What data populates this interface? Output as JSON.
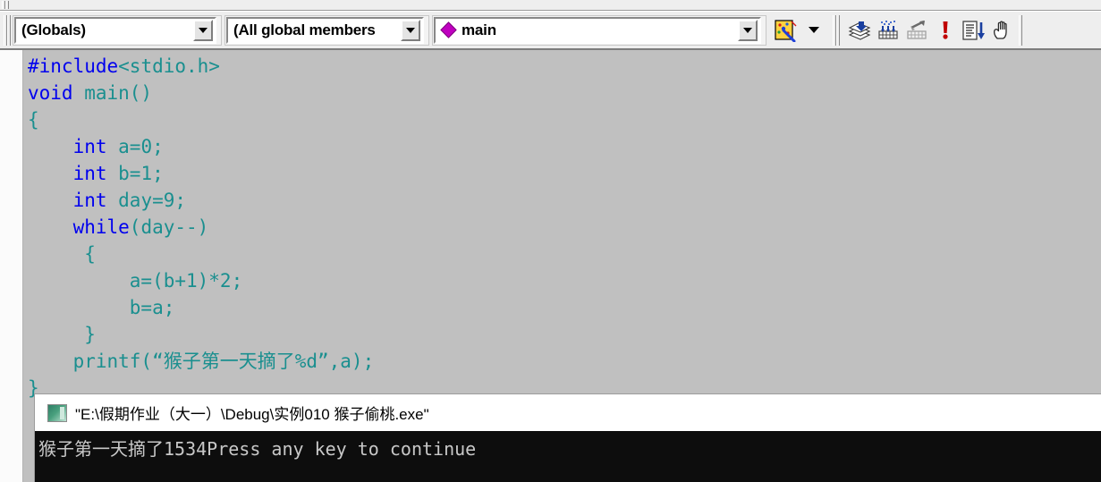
{
  "window": {
    "app": "Microsoft Visual C++ 6.0",
    "background_color": "#c0c0c0"
  },
  "toolbar": {
    "combos": [
      {
        "name": "class-combo",
        "value": "(Globals)",
        "icon": "none"
      },
      {
        "name": "filter-combo",
        "value": "(All global members",
        "icon": "none"
      },
      {
        "name": "member-combo",
        "value": "main",
        "icon": "diamond-magenta"
      }
    ],
    "wizard_button": {
      "label": "WizardBar Actions",
      "icon": "wizard-wand-icon"
    },
    "wizard_dropdown": {
      "label": "WizardBar Actions Menu",
      "icon": "caret-down-icon"
    },
    "debug_buttons": [
      {
        "name": "insert-remove-breakpoint",
        "label": "Insert/Remove Breakpoint",
        "icon": "breakpoint-layers-icon",
        "enabled": true
      },
      {
        "name": "enable-breakpoint",
        "label": "Enable Breakpoint",
        "icon": "enable-breakpoint-icon",
        "enabled": true
      },
      {
        "name": "disable-breakpoint",
        "label": "Disable Breakpoint",
        "icon": "disable-breakpoint-icon",
        "enabled": false
      },
      {
        "name": "breakpoints",
        "label": "Breakpoints",
        "icon": "red-exclamation-icon",
        "enabled": true
      },
      {
        "name": "show-next-statement",
        "label": "Show Next Statement",
        "icon": "next-statement-icon",
        "enabled": true
      },
      {
        "name": "pointer-hand",
        "label": "Hand Tool",
        "icon": "hand-icon",
        "enabled": true
      }
    ]
  },
  "colors": {
    "keyword": "#0000ee",
    "plain": "#1a8f8f",
    "editor_bg": "#c0c0c0",
    "gutter_bg": "#fbfbfb",
    "console_bg": "#0d0d0d",
    "console_fg": "#c8c8c8",
    "diamond": "#c000c0"
  },
  "editor": {
    "name": "source-editor",
    "lines": [
      {
        "n": 1,
        "tokens": [
          {
            "t": "#include",
            "c": "kw"
          },
          {
            "t": "<stdio.h>",
            "c": "pl"
          }
        ]
      },
      {
        "n": 2,
        "tokens": [
          {
            "t": "void",
            "c": "kw"
          },
          {
            "t": " main()",
            "c": "pl"
          }
        ]
      },
      {
        "n": 3,
        "tokens": [
          {
            "t": "{",
            "c": "pl"
          }
        ]
      },
      {
        "n": 4,
        "tokens": [
          {
            "t": "    ",
            "c": "pl"
          },
          {
            "t": "int",
            "c": "kw"
          },
          {
            "t": " a=0;",
            "c": "pl"
          }
        ]
      },
      {
        "n": 5,
        "tokens": [
          {
            "t": "    ",
            "c": "pl"
          },
          {
            "t": "int",
            "c": "kw"
          },
          {
            "t": " b=1;",
            "c": "pl"
          }
        ]
      },
      {
        "n": 6,
        "tokens": [
          {
            "t": "    ",
            "c": "pl"
          },
          {
            "t": "int",
            "c": "kw"
          },
          {
            "t": " day=9;",
            "c": "pl"
          }
        ]
      },
      {
        "n": 7,
        "tokens": [
          {
            "t": "    ",
            "c": "pl"
          },
          {
            "t": "while",
            "c": "kw"
          },
          {
            "t": "(day--)",
            "c": "pl"
          }
        ]
      },
      {
        "n": 8,
        "tokens": [
          {
            "t": "     {",
            "c": "pl"
          }
        ]
      },
      {
        "n": 9,
        "tokens": [
          {
            "t": "         a=(b+1)*2;",
            "c": "pl"
          }
        ]
      },
      {
        "n": 10,
        "tokens": [
          {
            "t": "         b=a;",
            "c": "pl"
          }
        ]
      },
      {
        "n": 11,
        "tokens": [
          {
            "t": "     }",
            "c": "pl"
          }
        ]
      },
      {
        "n": 12,
        "tokens": [
          {
            "t": "    printf(“猴子第一天摘了%d”,a);",
            "c": "pl"
          }
        ]
      },
      {
        "n": 13,
        "tokens": [
          {
            "t": "}",
            "c": "pl"
          }
        ]
      }
    ]
  },
  "console": {
    "name": "console-window",
    "title": "\"E:\\假期作业（大一）\\Debug\\实例010 猴子偷桃.exe\"",
    "icon": "console-app-icon",
    "output_lines": [
      "猴子第一天摘了1534Press any key to continue"
    ]
  }
}
